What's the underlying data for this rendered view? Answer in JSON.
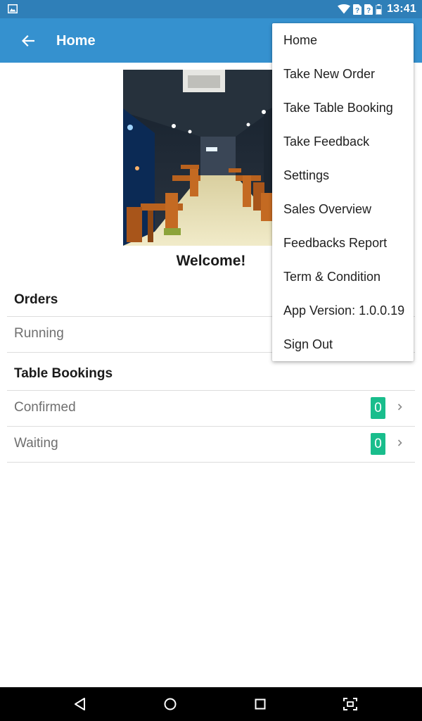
{
  "status_bar": {
    "time": "13:41",
    "icons": [
      "image-notification-icon",
      "wifi-icon",
      "sim-1-icon",
      "sim-2-icon",
      "battery-icon"
    ],
    "sim1_label": "?",
    "sim2_label": "?"
  },
  "app_bar": {
    "title": "Home",
    "back_icon": "arrow-left-icon"
  },
  "welcome_text": "Welcome!",
  "orders": {
    "header": "Orders",
    "rows": [
      {
        "label": "Running"
      }
    ]
  },
  "table_bookings": {
    "header": "Table Bookings",
    "rows": [
      {
        "label": "Confirmed",
        "count": "0"
      },
      {
        "label": "Waiting",
        "count": "0"
      }
    ]
  },
  "menu": {
    "items": [
      {
        "label": "Home"
      },
      {
        "label": "Take New Order"
      },
      {
        "label": "Take Table Booking"
      },
      {
        "label": "Take Feedback"
      },
      {
        "label": "Settings"
      },
      {
        "label": "Sales Overview"
      },
      {
        "label": "Feedbacks Report"
      },
      {
        "label": "Term & Condition"
      },
      {
        "label": "App Version: 1.0.0.19"
      },
      {
        "label": "Sign Out"
      }
    ]
  },
  "nav_bar": {
    "icons": [
      "back-triangle-icon",
      "home-circle-icon",
      "recents-square-icon",
      "screenshot-icon"
    ]
  },
  "colors": {
    "status_bar": "#2f7fb8",
    "app_bar": "#3591cf",
    "badge": "#19bd8c",
    "divider": "#dddddd",
    "muted_text": "#6f6f6f"
  }
}
